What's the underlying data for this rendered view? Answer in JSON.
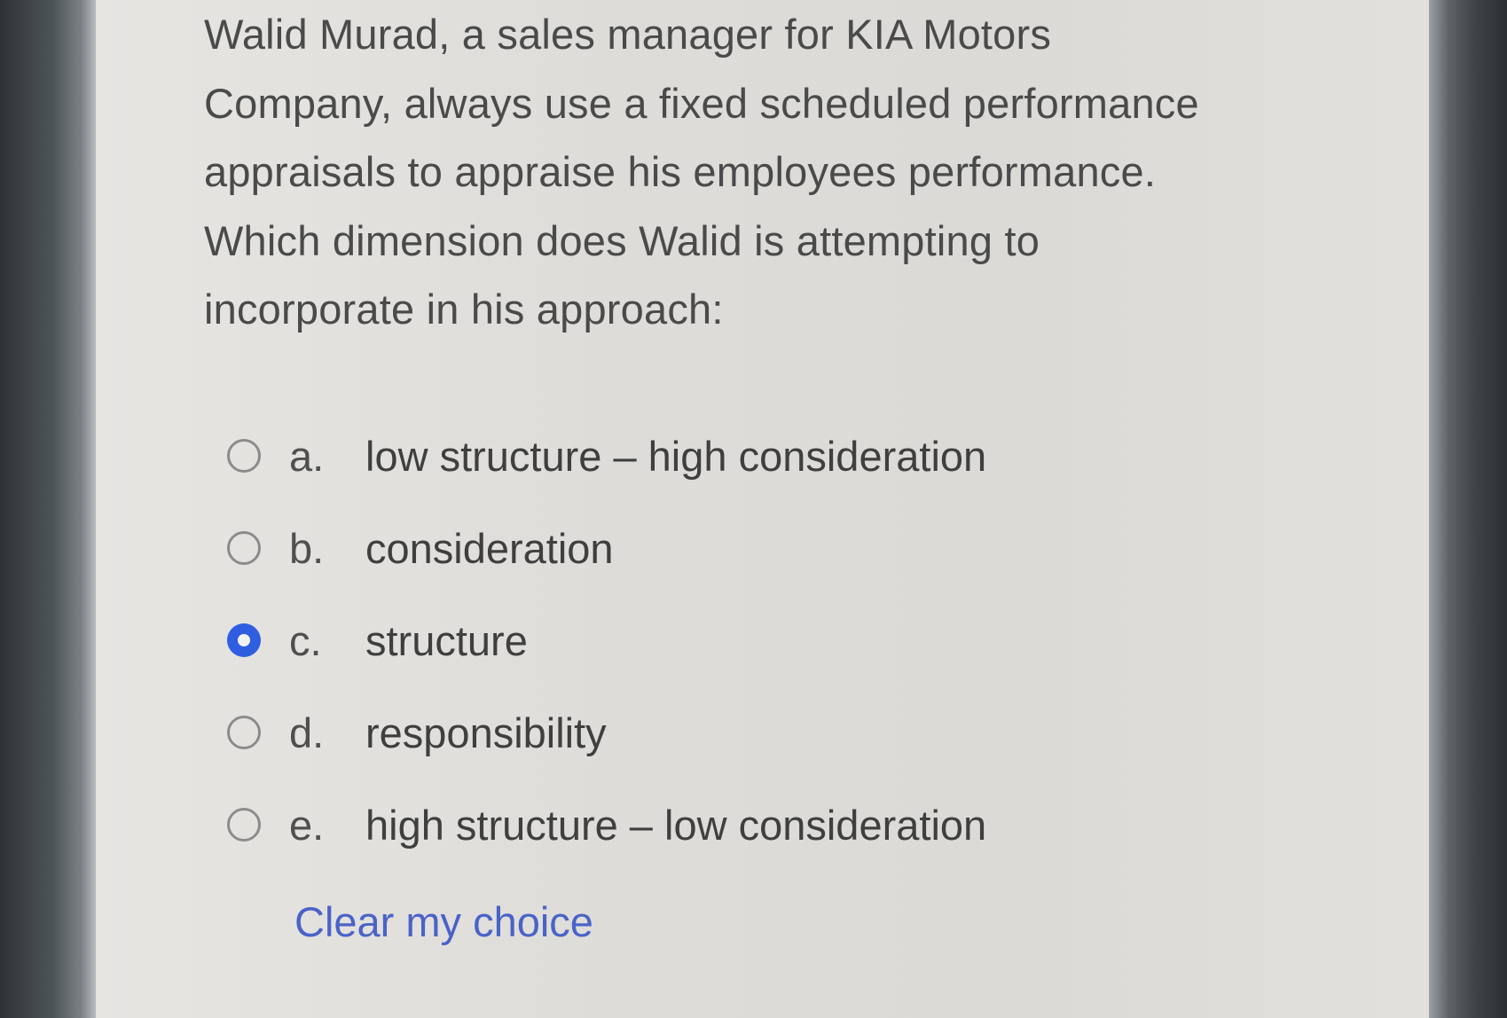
{
  "question": {
    "lines": [
      "Walid Murad, a sales manager for KIA Motors",
      "Company, always use a fixed scheduled performance",
      "appraisals to appraise his employees performance.",
      "Which dimension does Walid is attempting to",
      "incorporate in his approach:"
    ]
  },
  "answers": [
    {
      "letter": "a.",
      "label": "low structure – high consideration",
      "selected": false
    },
    {
      "letter": "b.",
      "label": "consideration",
      "selected": false
    },
    {
      "letter": "c.",
      "label": "structure",
      "selected": true
    },
    {
      "letter": "d.",
      "label": "responsibility",
      "selected": false
    },
    {
      "letter": "e.",
      "label": "high structure – low consideration",
      "selected": false
    }
  ],
  "clear_choice_label": "Clear my choice",
  "colors": {
    "accent": "#2f5fe0",
    "link": "#4a63c8",
    "text": "#4a4a4a"
  }
}
